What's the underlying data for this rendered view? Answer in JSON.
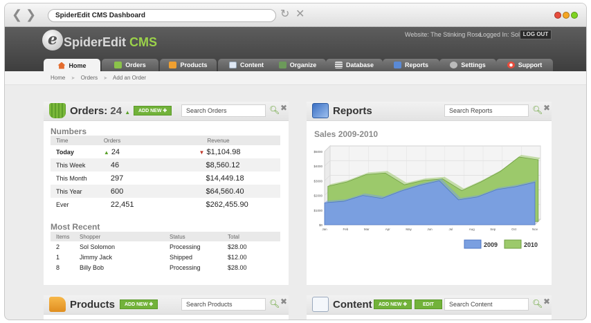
{
  "browser": {
    "title": "SpiderEdit CMS Dashboard",
    "back_icon": "chevron-left-icon",
    "forward_icon": "chevron-right-icon",
    "reload_icon": "reload-icon",
    "stop_icon": "stop-icon",
    "window_dots": [
      "#e74c3c",
      "#f5a623",
      "#7ed321"
    ]
  },
  "header": {
    "logo_mark": "e",
    "logo_name": "SpiderEdit",
    "logo_cms": "CMS",
    "website_label": "Website: The Stinking Rose",
    "logged_label": "Logged In: Sol",
    "logout_label": "LOG OUT"
  },
  "tabs": [
    {
      "label": "Home",
      "icon": "home-icon"
    },
    {
      "label": "Orders",
      "icon": "basket-icon"
    },
    {
      "label": "Products",
      "icon": "tag-icon"
    },
    {
      "label": "Content",
      "icon": "document-icon"
    },
    {
      "label": "Organize",
      "icon": "image-icon"
    },
    {
      "label": "Database",
      "icon": "database-icon"
    },
    {
      "label": "Reports",
      "icon": "chart-icon"
    },
    {
      "label": "Settings",
      "icon": "gear-icon"
    },
    {
      "label": "Support",
      "icon": "lifebuoy-icon"
    }
  ],
  "breadcrumb": [
    "Home",
    "Orders",
    "Add an Order"
  ],
  "orders": {
    "title": "Orders:",
    "count": "24",
    "add_new": "ADD NEW",
    "search_placeholder": "Search Orders",
    "numbers_heading": "Numbers",
    "columns": [
      "Time",
      "Orders",
      "Revenue"
    ],
    "rows": [
      {
        "time": "Today",
        "orders": "24",
        "revenue": "$1,104.98"
      },
      {
        "time": "This Week",
        "orders": "46",
        "revenue": "$8,560.12"
      },
      {
        "time": "This Month",
        "orders": "297",
        "revenue": "$14,449.18"
      },
      {
        "time": "This Year",
        "orders": "600",
        "revenue": "$64,560.40"
      },
      {
        "time": "Ever",
        "orders": "22,451",
        "revenue": "$262,455.90"
      }
    ],
    "recent_heading": "Most Recent",
    "recent_columns": [
      "Items",
      "Shopper",
      "Status",
      "Total"
    ],
    "recent_rows": [
      {
        "items": "2",
        "shopper": "Sol Solomon",
        "status": "Processing",
        "total": "$28.00"
      },
      {
        "items": "1",
        "shopper": "Jimmy Jack",
        "status": "Shipped",
        "total": "$12.00"
      },
      {
        "items": "8",
        "shopper": "Billy Bob",
        "status": "Processing",
        "total": "$28.00"
      }
    ]
  },
  "reports": {
    "title": "Reports",
    "search_placeholder": "Search Reports",
    "chart_title": "Sales 2009-2010"
  },
  "products": {
    "title": "Products",
    "add_new": "ADD NEW",
    "search_placeholder": "Search Products"
  },
  "content": {
    "title": "Content",
    "add_new": "ADD NEW",
    "edit": "EDIT",
    "search_placeholder": "Search Content"
  },
  "chart_data": {
    "type": "area",
    "title": "Sales 2009-2010",
    "categories": [
      "Jan",
      "Feb",
      "Mar",
      "Apr",
      "May",
      "Jun",
      "Jul",
      "Aug",
      "Sep",
      "Oct",
      "Nov"
    ],
    "y_ticks": [
      "$0",
      "$1000",
      "$2000",
      "$3000",
      "$4000",
      "$5000"
    ],
    "ylim": [
      0,
      5000
    ],
    "series": [
      {
        "name": "2009",
        "color": "#7a9fe0",
        "values": [
          1500,
          1600,
          2000,
          1800,
          2300,
          2700,
          3000,
          1700,
          1900,
          2400,
          2600,
          2900
        ]
      },
      {
        "name": "2010",
        "color": "#9cc96b",
        "values": [
          2400,
          2700,
          3200,
          3300,
          2500,
          2800,
          2900,
          2100,
          2700,
          3400,
          4400,
          4200
        ]
      }
    ],
    "legend": "bottom-right",
    "grid": true
  }
}
